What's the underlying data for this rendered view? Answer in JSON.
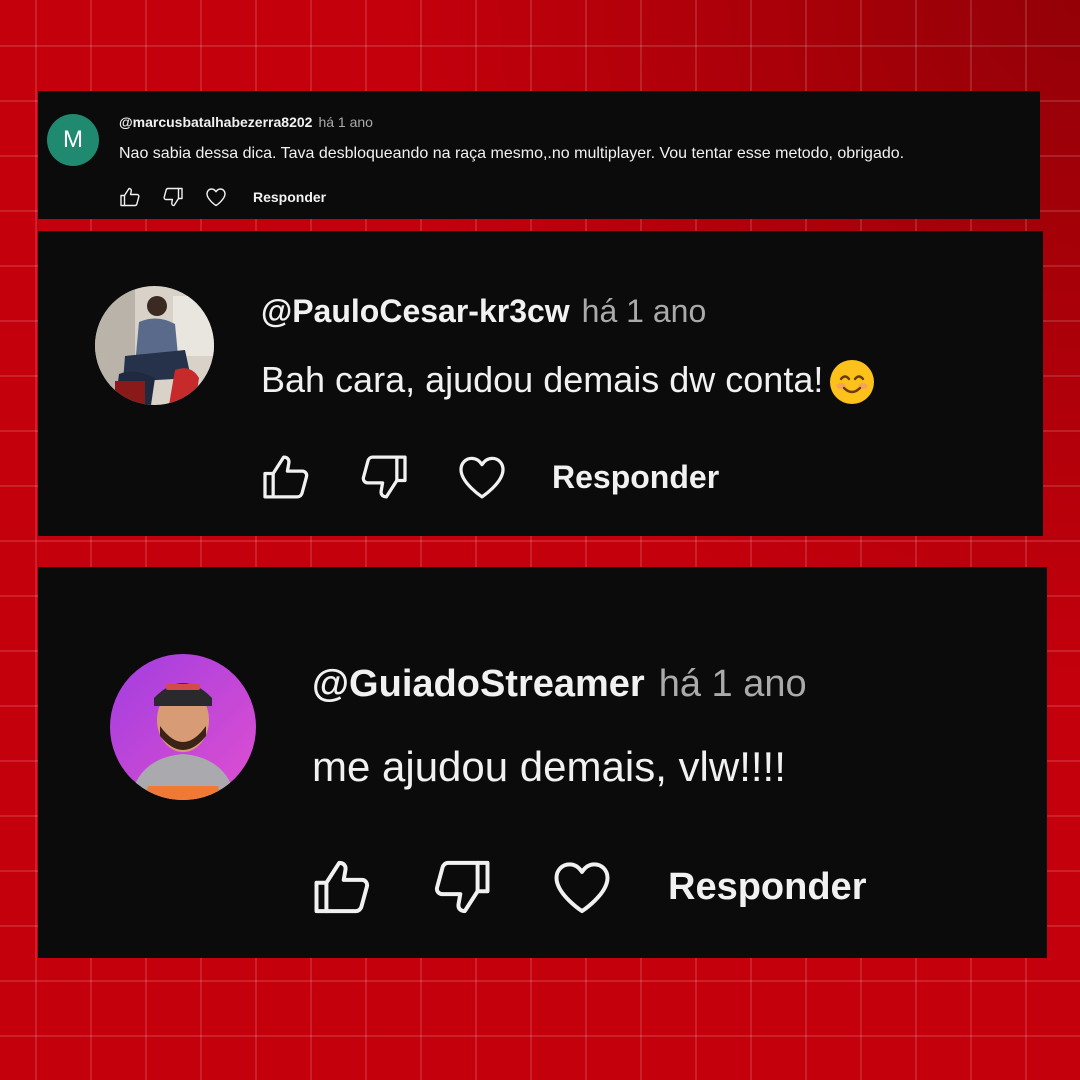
{
  "comments": [
    {
      "avatar_letter": "M",
      "avatar_color": "#1f8a70",
      "handle": "@marcusbatalhabezerra8202",
      "time": "há 1 ano",
      "text": "Nao sabia dessa dica. Tava desbloqueando na raça mesmo,.no multiplayer. Vou tentar esse metodo, obrigado.",
      "reply_label": "Responder"
    },
    {
      "avatar": "person-photo",
      "handle": "@PauloCesar-kr3cw",
      "time": "há 1 ano",
      "text": "Bah cara, ajudou demais dw conta!",
      "emoji": "smiling-face-emoji",
      "reply_label": "Responder"
    },
    {
      "avatar": "person-photo",
      "avatar_color": "#b347e6",
      "handle": "@GuiadoStreamer",
      "time": "há 1 ano",
      "text": "me ajudou demais, vlw!!!!",
      "reply_label": "Responder"
    }
  ],
  "icons": [
    "thumb-up-icon",
    "thumb-down-icon",
    "heart-icon"
  ],
  "colors": {
    "background": "#c4000c",
    "card": "#0b0b0b",
    "text": "#f1f1f1",
    "muted": "#aaaaaa"
  }
}
